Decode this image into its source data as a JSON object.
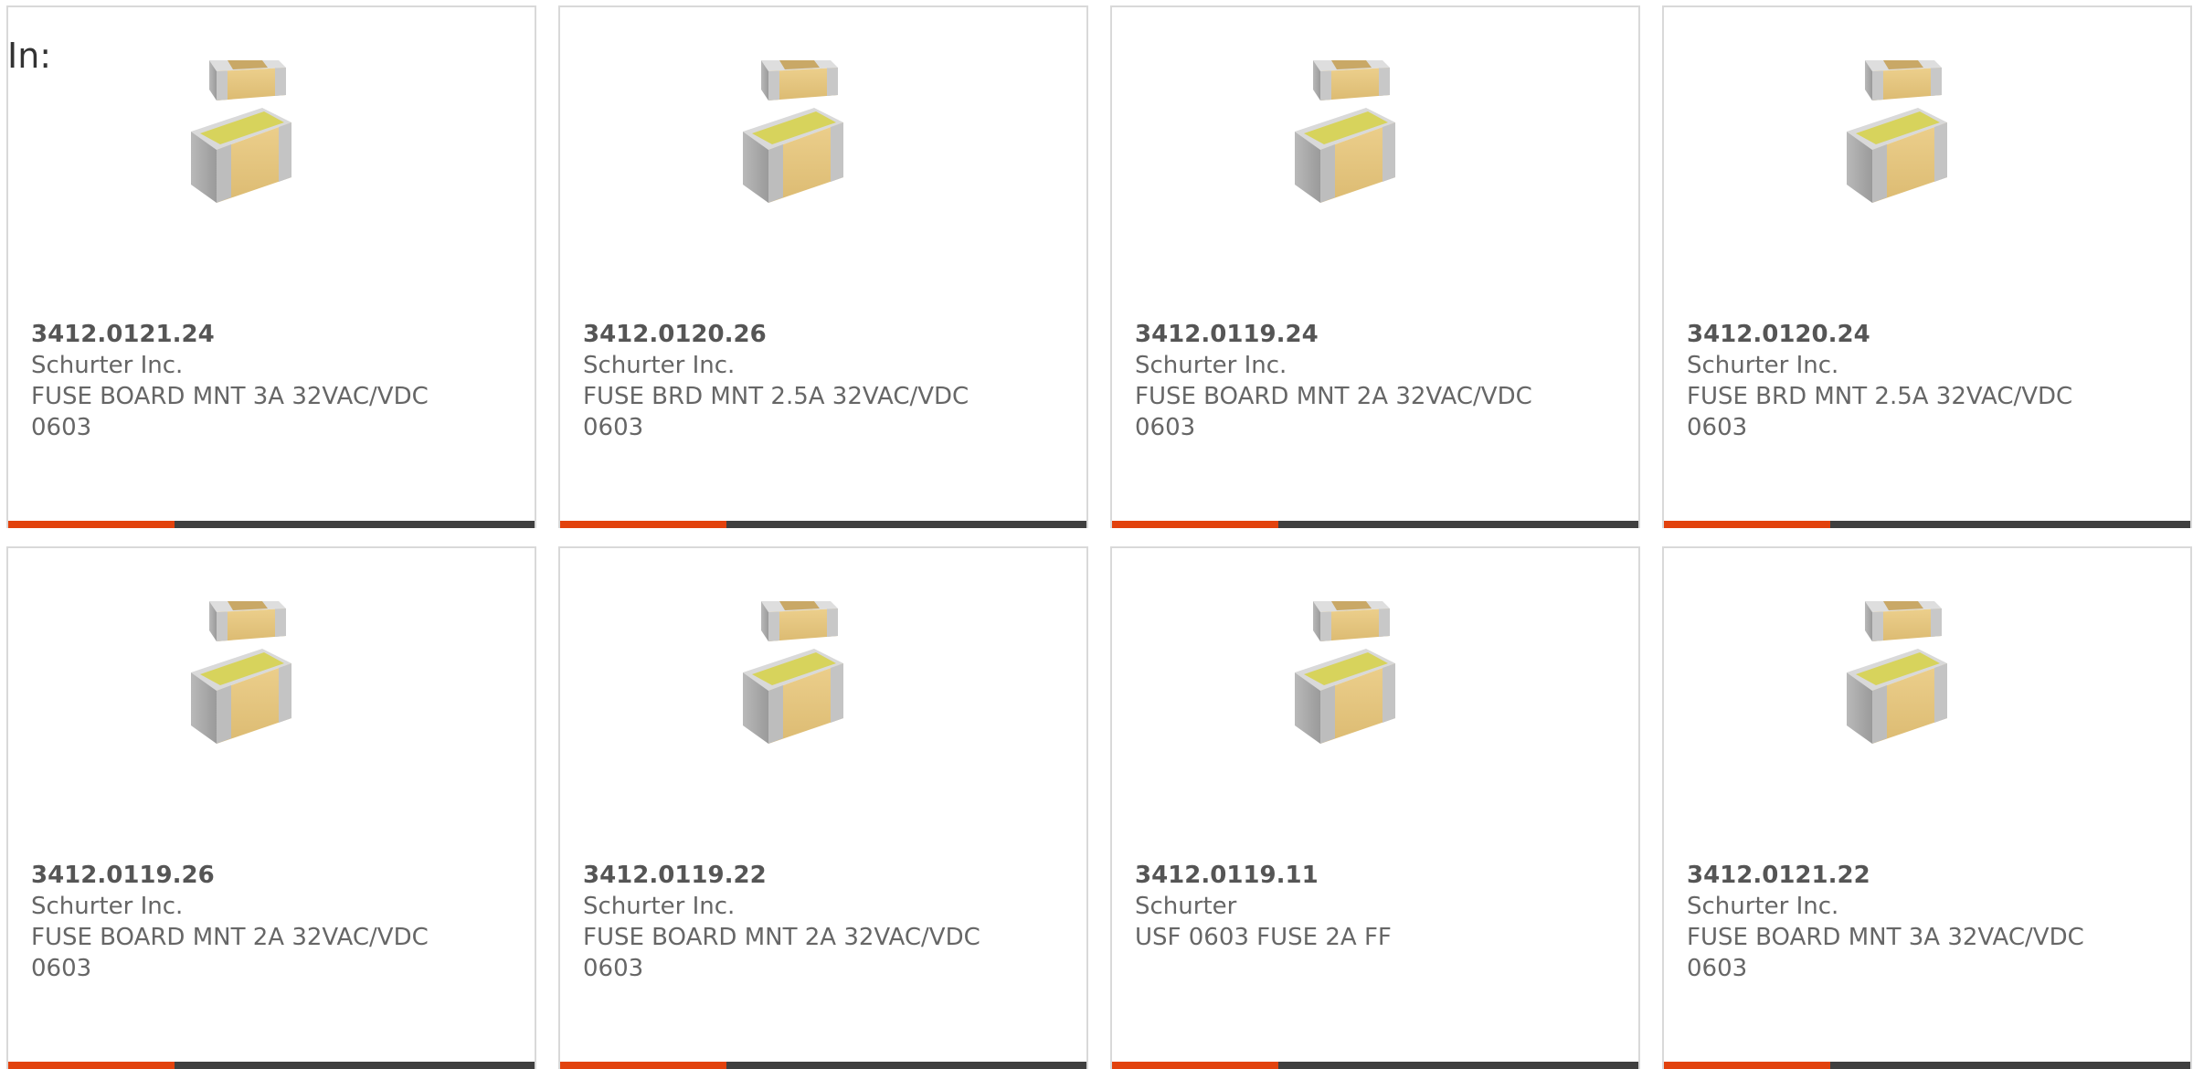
{
  "header": {
    "in_label": "In:"
  },
  "colors": {
    "accent": "#e2420d",
    "bar": "#3f3f3f",
    "border": "#d9d9d9",
    "text": "#666666"
  },
  "products": [
    {
      "part_number": "3412.0121.24",
      "manufacturer": "Schurter Inc.",
      "description": "FUSE BOARD MNT 3A 32VAC/VDC",
      "package": "0603",
      "image_icon": "smd-fuse-icon"
    },
    {
      "part_number": "3412.0120.26",
      "manufacturer": "Schurter Inc.",
      "description": "FUSE BRD MNT 2.5A 32VAC/VDC",
      "package": "0603",
      "image_icon": "smd-fuse-icon"
    },
    {
      "part_number": "3412.0119.24",
      "manufacturer": "Schurter Inc.",
      "description": "FUSE BOARD MNT 2A 32VAC/VDC",
      "package": "0603",
      "image_icon": "smd-fuse-icon"
    },
    {
      "part_number": "3412.0120.24",
      "manufacturer": "Schurter Inc.",
      "description": "FUSE BRD MNT 2.5A 32VAC/VDC",
      "package": "0603",
      "image_icon": "smd-fuse-icon"
    },
    {
      "part_number": "3412.0119.26",
      "manufacturer": "Schurter Inc.",
      "description": "FUSE BOARD MNT 2A 32VAC/VDC",
      "package": "0603",
      "image_icon": "smd-fuse-icon"
    },
    {
      "part_number": "3412.0119.22",
      "manufacturer": "Schurter Inc.",
      "description": "FUSE BOARD MNT 2A 32VAC/VDC",
      "package": "0603",
      "image_icon": "smd-fuse-icon"
    },
    {
      "part_number": "3412.0119.11",
      "manufacturer": "Schurter",
      "description": "USF 0603 FUSE 2A FF",
      "package": "",
      "image_icon": "smd-fuse-icon"
    },
    {
      "part_number": "3412.0121.22",
      "manufacturer": "Schurter Inc.",
      "description": "FUSE BOARD MNT 3A 32VAC/VDC",
      "package": "0603",
      "image_icon": "smd-fuse-icon"
    }
  ]
}
